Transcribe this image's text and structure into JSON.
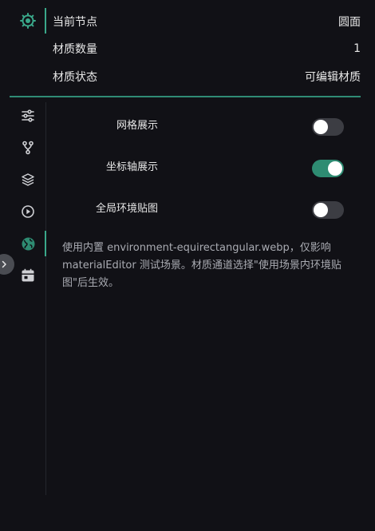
{
  "node_info": {
    "current_node": {
      "label": "当前节点",
      "value": "圆面"
    },
    "material_count": {
      "label": "材质数量",
      "value": "1"
    },
    "material_status": {
      "label": "材质状态",
      "value": "可编辑材质"
    }
  },
  "sidebar": {
    "top_icon": "material-node-icon",
    "items": [
      {
        "icon": "sliders-icon",
        "active": false
      },
      {
        "icon": "branch-icon",
        "active": false
      },
      {
        "icon": "layers-icon",
        "active": false
      },
      {
        "icon": "play-circle-icon",
        "active": false
      },
      {
        "icon": "globe-icon",
        "active": true
      },
      {
        "icon": "calendar-icon",
        "active": false
      }
    ],
    "collapse_icon": "chevron-right-icon"
  },
  "settings": [
    {
      "label": "网格展示",
      "on": false
    },
    {
      "label": "坐标轴展示",
      "on": true
    },
    {
      "label": "全局环境贴图",
      "on": false
    }
  ],
  "description": "使用内置 environment-equirectangular.webp，仅影响 materialEditor 测试场景。材质通道选择\"使用场景内环境贴图\"后生效。",
  "colors": {
    "accent": "#2e8c72",
    "background": "#111116",
    "toggle_off": "#3c3d43",
    "icon": "#cfd0d4"
  }
}
